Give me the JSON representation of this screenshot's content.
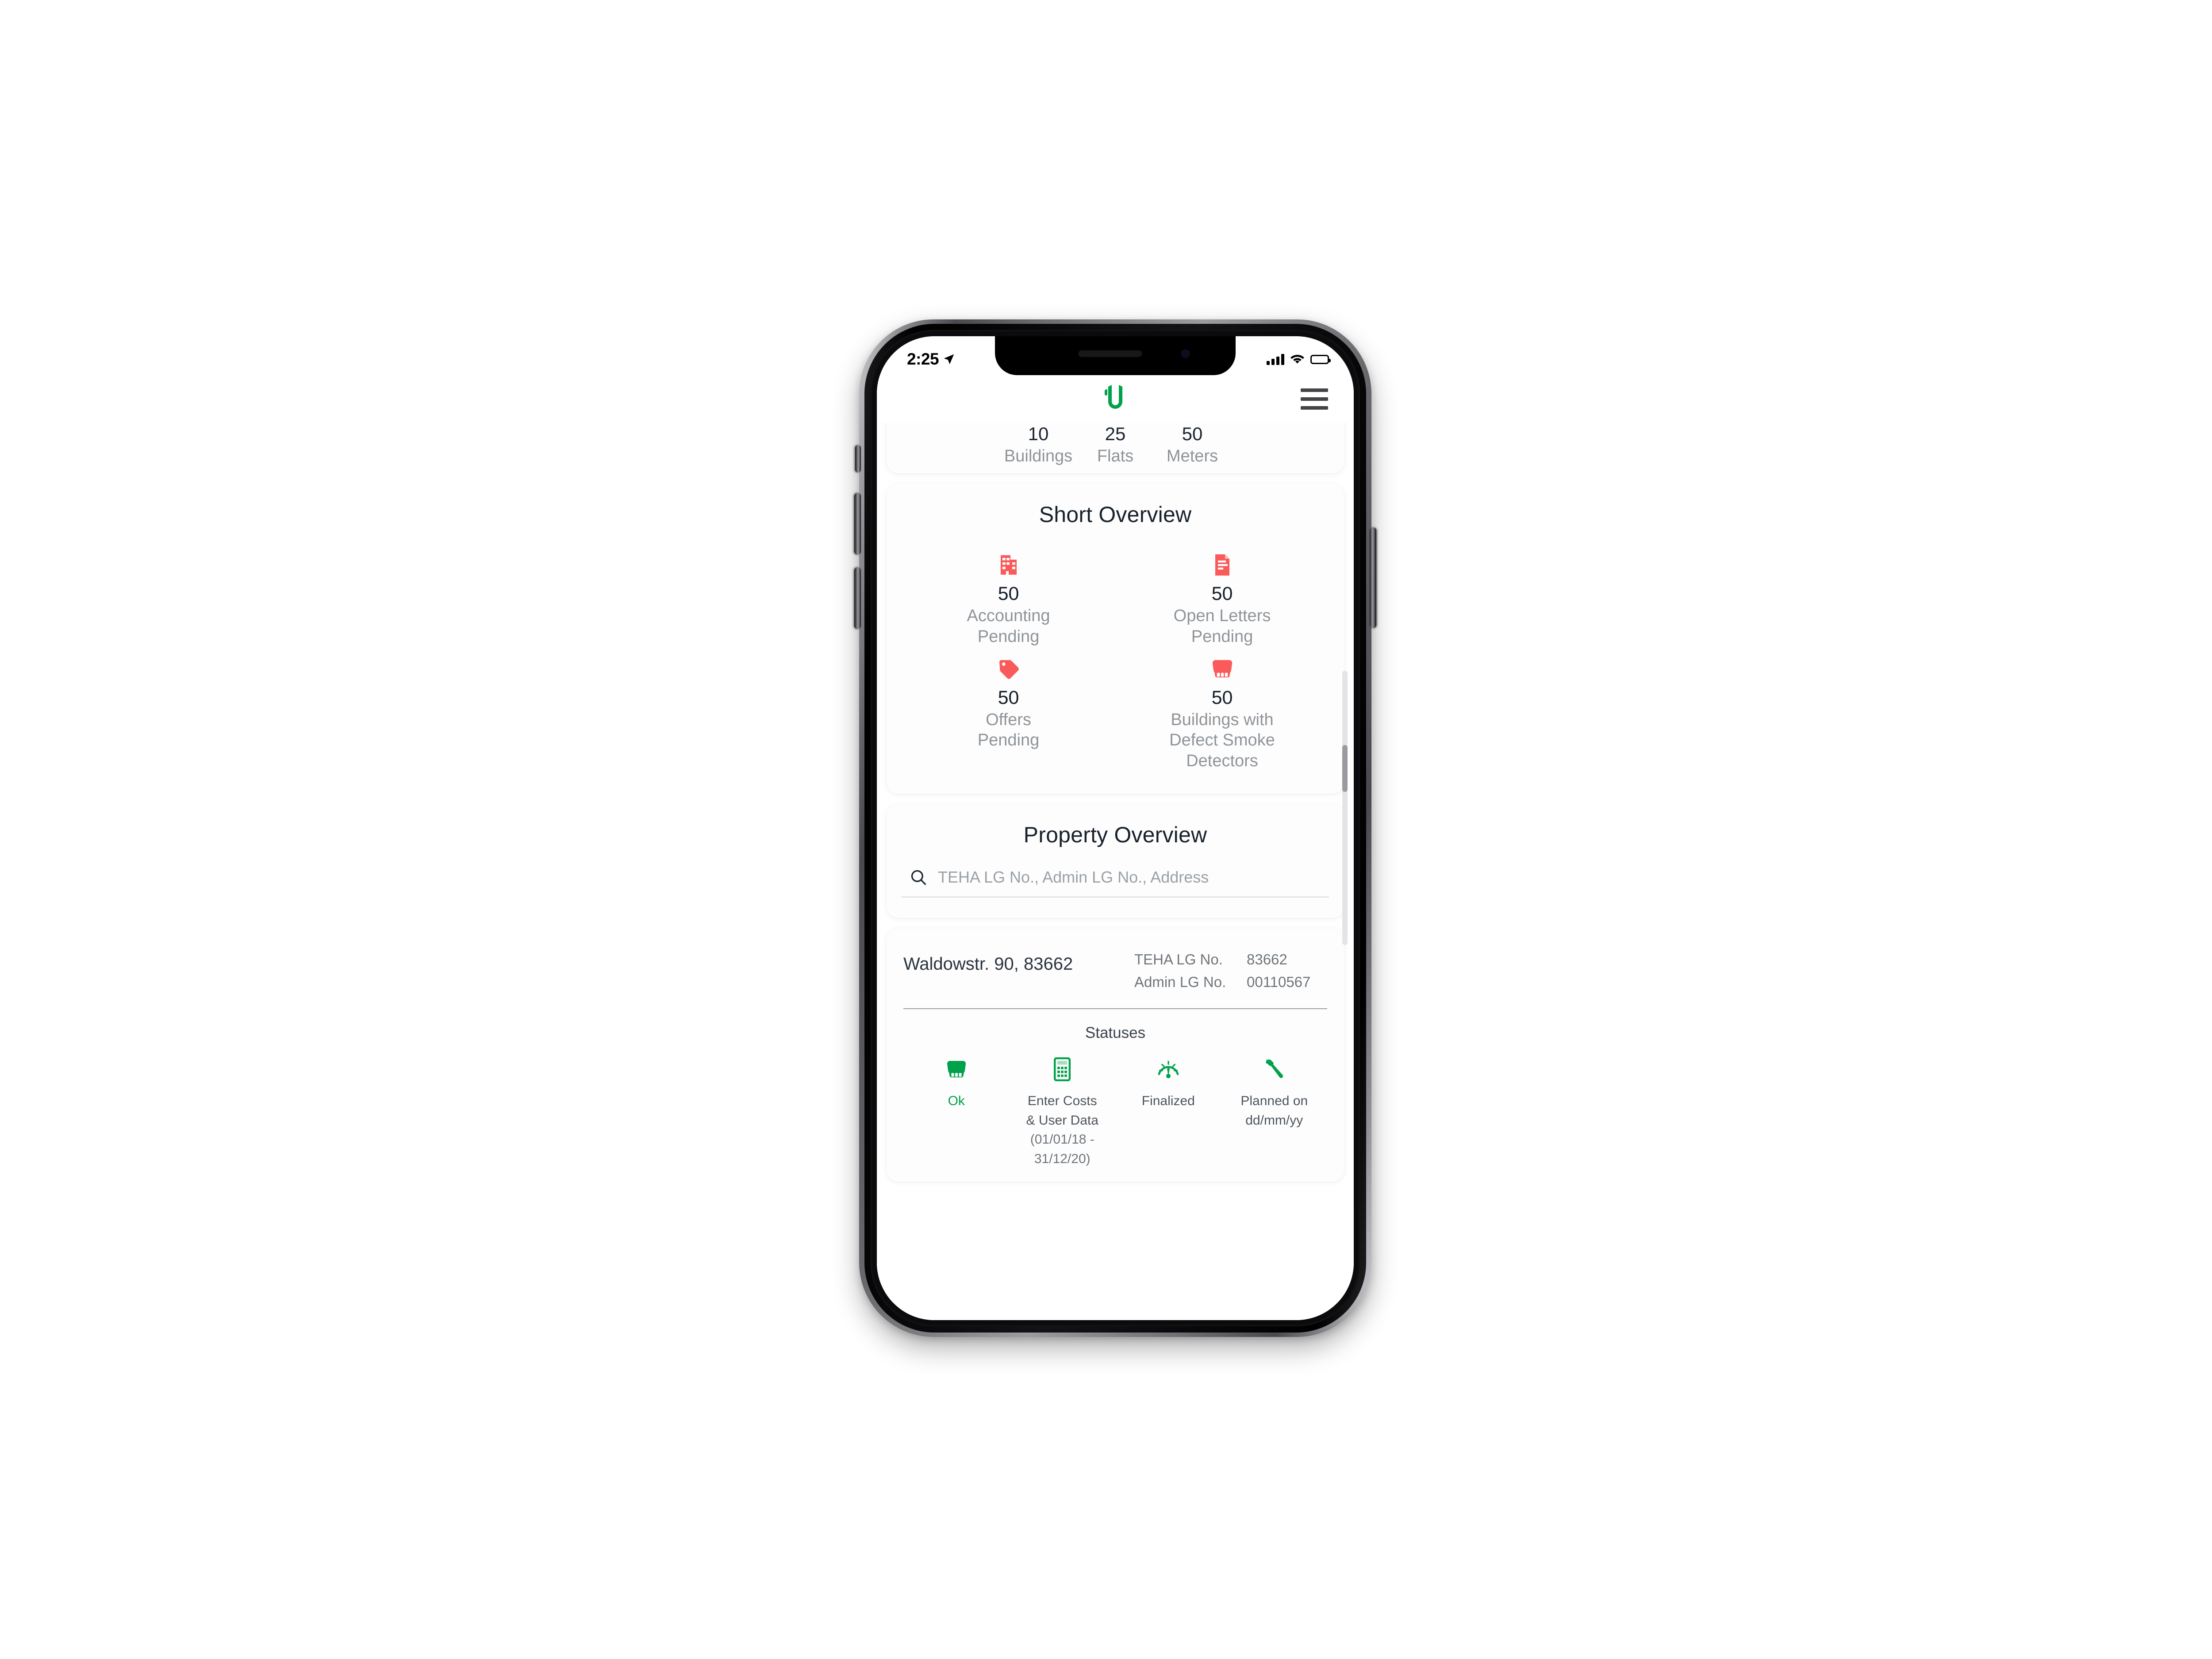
{
  "device": {
    "statusbar": {
      "time": "2:25",
      "location_icon": "location-arrow-icon",
      "signal_icon": "cellular-signal-icon",
      "wifi_icon": "wifi-icon",
      "battery_icon": "battery-full-icon"
    }
  },
  "header": {
    "logo_icon": "app-logo-icon",
    "logo_color": "#00A14B",
    "menu_icon": "hamburger-menu-icon"
  },
  "summary": {
    "items": [
      {
        "value": "10",
        "label": "Buildings"
      },
      {
        "value": "25",
        "label": "Flats"
      },
      {
        "value": "50",
        "label": "Meters"
      }
    ]
  },
  "short_overview": {
    "title": "Short Overview",
    "accent_color": "#FA5A5A",
    "items": [
      {
        "icon": "building-icon",
        "value": "50",
        "label": "Accounting\nPending"
      },
      {
        "icon": "document-letter-icon",
        "value": "50",
        "label": "Open Letters\nPending"
      },
      {
        "icon": "price-tag-icon",
        "value": "50",
        "label": "Offers\nPending"
      },
      {
        "icon": "smoke-detector-icon",
        "value": "50",
        "label": "Buildings with\nDefect Smoke\nDetectors"
      }
    ]
  },
  "property_overview": {
    "title": "Property Overview",
    "search": {
      "icon": "search-icon",
      "placeholder": "TEHA LG No., Admin LG No., Address",
      "value": ""
    }
  },
  "property_result": {
    "address": "Waldowstr. 90, 83662",
    "ids": [
      {
        "label": "TEHA LG No.",
        "value": "83662"
      },
      {
        "label": "Admin LG No.",
        "value": "00110567"
      }
    ],
    "statuses_title": "Statuses",
    "accent_color": "#00A14B",
    "statuses": [
      {
        "icon": "smoke-detector-icon",
        "label": "Ok",
        "sub": "",
        "state": "ok"
      },
      {
        "icon": "calculator-icon",
        "label": "Enter Costs\n& User Data",
        "sub": "(01/01/18 - 31/12/20)",
        "state": "default"
      },
      {
        "icon": "gauge-meter-icon",
        "label": "Finalized",
        "sub": "",
        "state": "default"
      },
      {
        "icon": "wrench-icon",
        "label": "Planned on\ndd/mm/yy",
        "sub": "",
        "state": "default"
      }
    ]
  },
  "scrollbar": {
    "name": "vertical-scrollbar"
  }
}
